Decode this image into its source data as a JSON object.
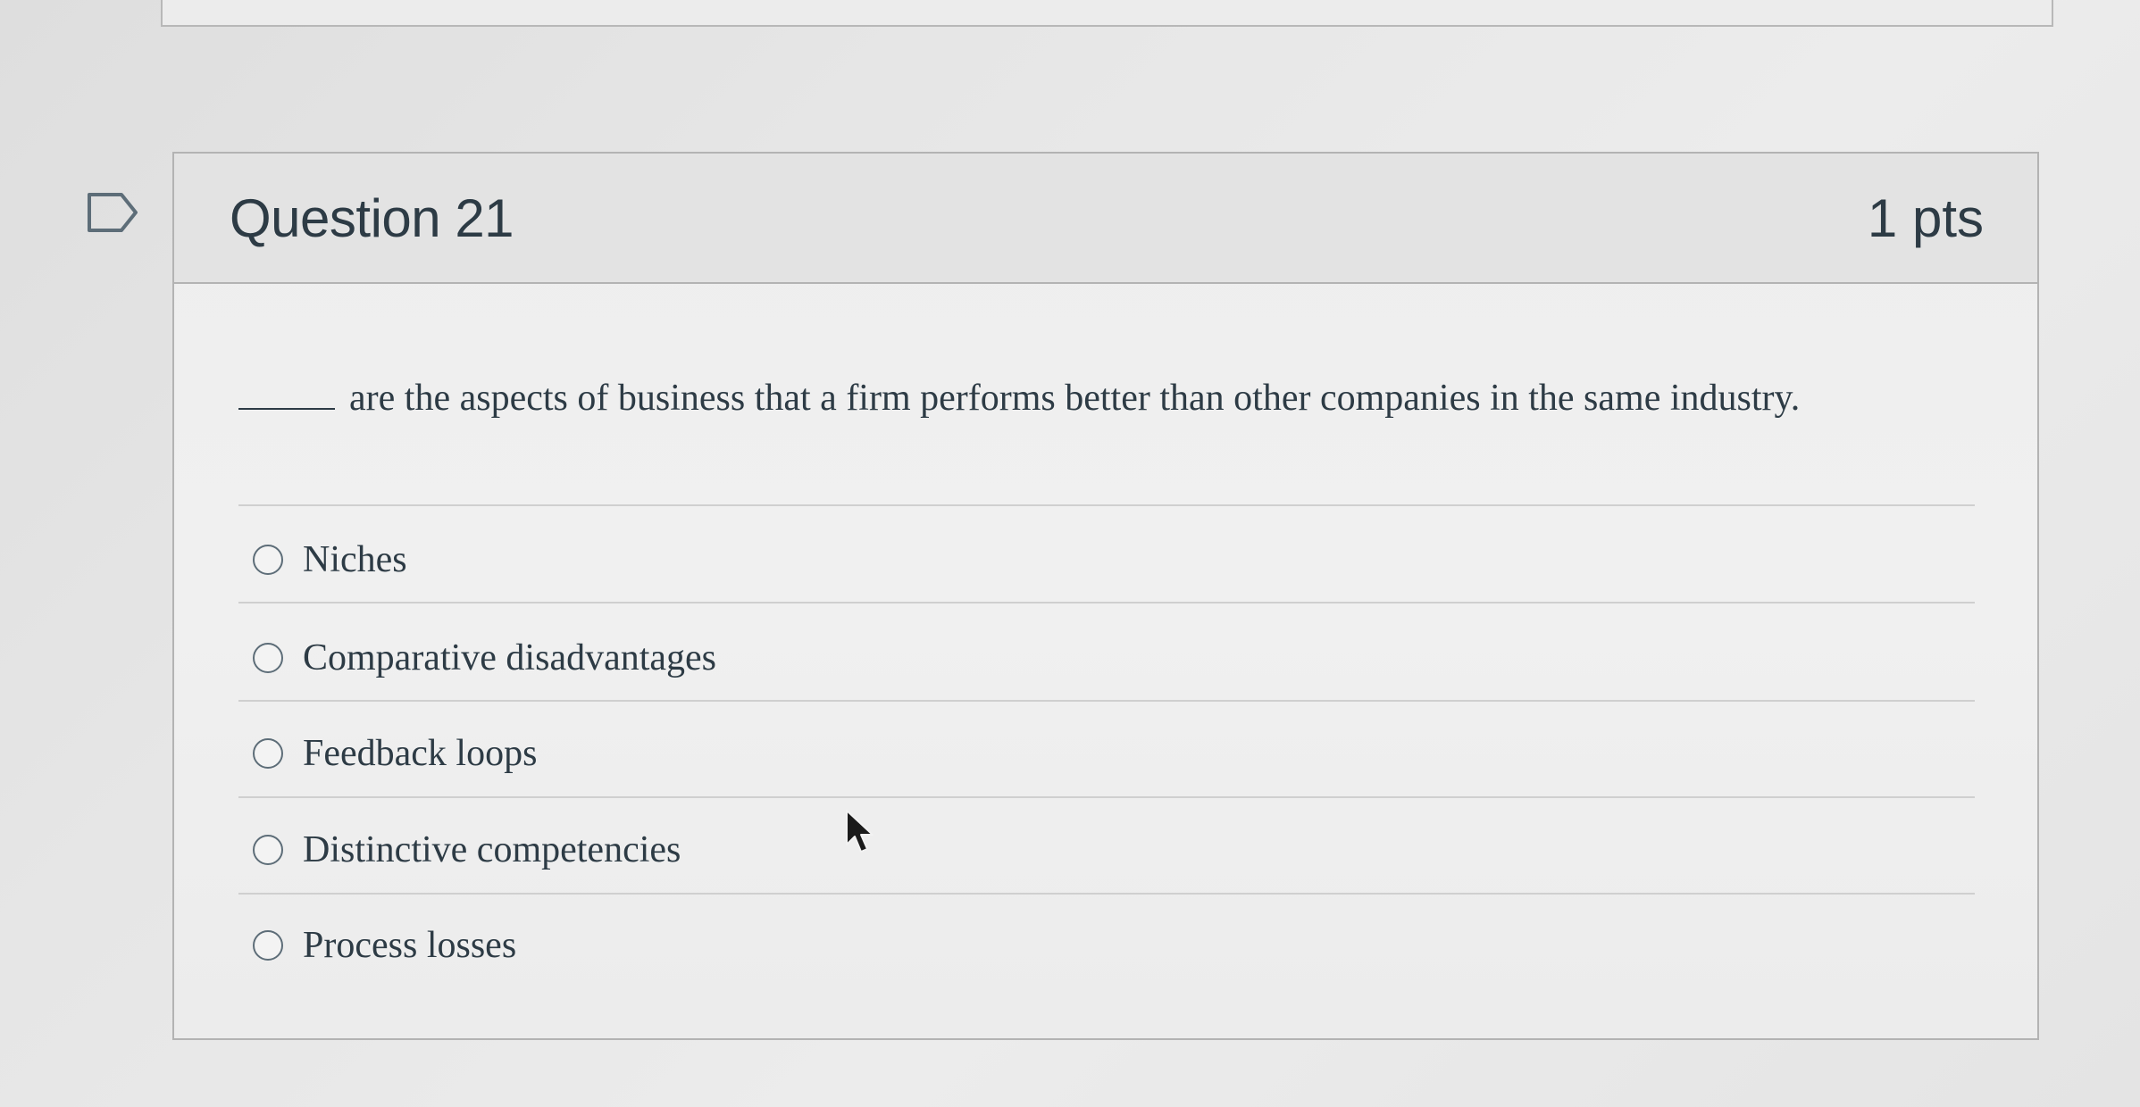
{
  "question": {
    "title": "Question 21",
    "points": "1 pts",
    "prompt_blank": "_____",
    "prompt": "are the aspects of business that a firm performs better than other companies in the same industry."
  },
  "answers": [
    {
      "label": "Niches",
      "selected": false
    },
    {
      "label": "Comparative disadvantages",
      "selected": false
    },
    {
      "label": "Feedback loops",
      "selected": false
    },
    {
      "label": "Distinctive competencies",
      "selected": false
    },
    {
      "label": "Process losses",
      "selected": false
    }
  ],
  "icons": {
    "flag": "flag-icon",
    "radio": "radio-icon",
    "cursor": "mouse-cursor-icon"
  },
  "colors": {
    "text": "#2d3b45",
    "border": "#b3b3b3",
    "header_bg": "#e3e3e3"
  }
}
